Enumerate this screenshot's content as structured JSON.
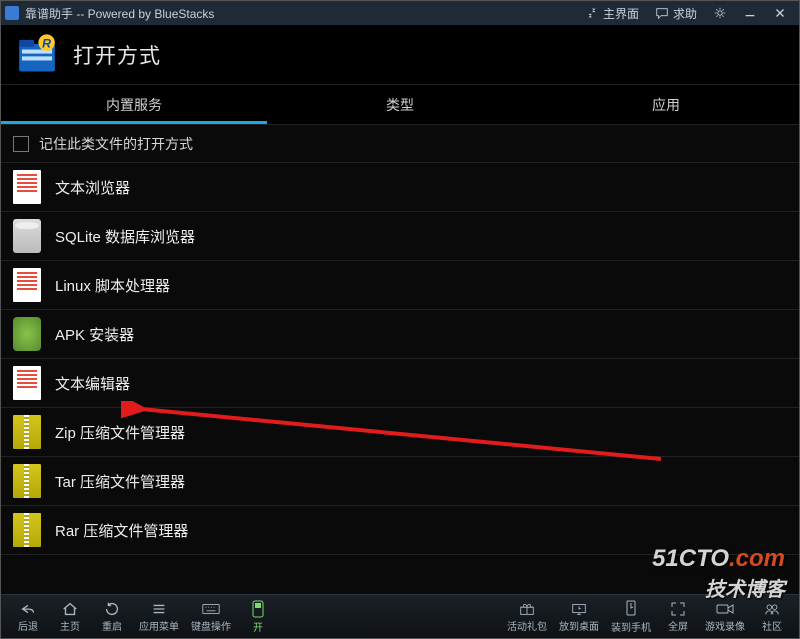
{
  "titlebar": {
    "title": "靠谱助手  -- Powered by BlueStacks",
    "main_btn": "主界面",
    "help_btn": "求助"
  },
  "header": {
    "page_title": "打开方式"
  },
  "tabs": [
    {
      "label": "内置服务",
      "active": true
    },
    {
      "label": "类型",
      "active": false
    },
    {
      "label": "应用",
      "active": false
    }
  ],
  "remember_label": "记住此类文件的打开方式",
  "items": [
    {
      "label": "文本浏览器",
      "icon": "doc"
    },
    {
      "label": "SQLite 数据库浏览器",
      "icon": "db"
    },
    {
      "label": "Linux 脚本处理器",
      "icon": "doc"
    },
    {
      "label": "APK 安装器",
      "icon": "android"
    },
    {
      "label": "文本编辑器",
      "icon": "doc"
    },
    {
      "label": "Zip 压缩文件管理器",
      "icon": "zip"
    },
    {
      "label": "Tar 压缩文件管理器",
      "icon": "zip"
    },
    {
      "label": "Rar 压缩文件管理器",
      "icon": "zip"
    }
  ],
  "bottombar": {
    "left": [
      {
        "label": "后退",
        "name": "back"
      },
      {
        "label": "主页",
        "name": "home"
      },
      {
        "label": "重启",
        "name": "restart"
      },
      {
        "label": "应用菜单",
        "name": "apps"
      },
      {
        "label": "键盘操作",
        "name": "keyboard"
      },
      {
        "label": "开",
        "name": "toggle-on"
      }
    ],
    "right": [
      {
        "label": "活动礼包",
        "name": "gift"
      },
      {
        "label": "放到桌面",
        "name": "to-desktop"
      },
      {
        "label": "装到手机",
        "name": "to-phone"
      },
      {
        "label": "全屏",
        "name": "fullscreen"
      },
      {
        "label": "游戏录像",
        "name": "record"
      },
      {
        "label": "社区",
        "name": "community"
      }
    ]
  },
  "watermark": {
    "line1a": "51CTO",
    "line1b": ".com",
    "line2": "技术博客"
  }
}
